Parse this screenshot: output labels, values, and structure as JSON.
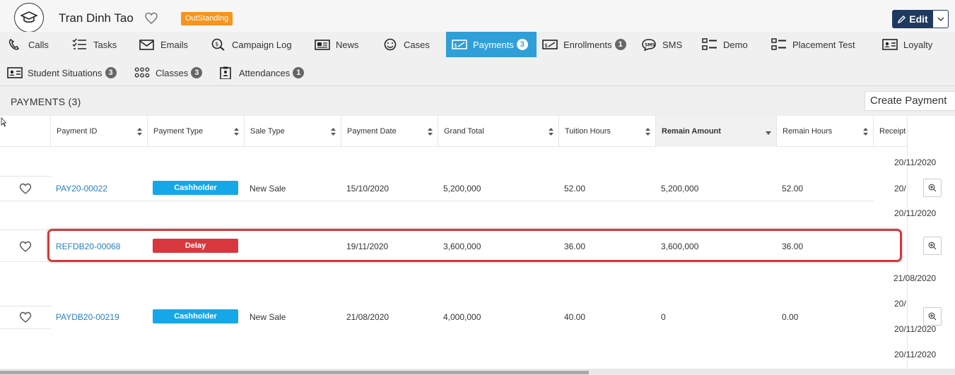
{
  "header": {
    "name": "Tran Dinh Tao",
    "status_badge": "OutStanding",
    "edit_label": "Edit",
    "brand_color": "#1f3a5f",
    "badge_color": "#f7941d"
  },
  "tabs": [
    {
      "label": "Calls",
      "icon": "phone-icon"
    },
    {
      "label": "Tasks",
      "icon": "checklist-icon"
    },
    {
      "label": "Emails",
      "icon": "envelope-icon"
    },
    {
      "label": "Campaign Log",
      "icon": "search-dollar-icon"
    },
    {
      "label": "News",
      "icon": "newspaper-icon"
    },
    {
      "label": "Cases",
      "icon": "smile-icon"
    },
    {
      "label": "Payments",
      "icon": "bill-icon",
      "count": "3",
      "active": true
    },
    {
      "label": "Enrollments",
      "icon": "bill-icon",
      "count": "1"
    },
    {
      "label": "SMS",
      "icon": "sms-icon"
    },
    {
      "label": "Demo",
      "icon": "list-icon"
    },
    {
      "label": "Placement Test",
      "icon": "list-icon"
    },
    {
      "label": "Loyalty",
      "icon": "id-card-icon"
    },
    {
      "label": "Student Situations",
      "icon": "id-card-icon",
      "count": "3"
    },
    {
      "label": "Classes",
      "icon": "group-icon",
      "count": "3"
    },
    {
      "label": "Attendances",
      "icon": "clipboard-icon",
      "count": "1"
    }
  ],
  "section": {
    "title": "PAYMENTS",
    "count": "(3)",
    "create_label": "Create Payment"
  },
  "columns": [
    "Payment ID",
    "Payment Type",
    "Sale Type",
    "Payment Date",
    "Grand Total",
    "Tuition Hours",
    "Remain Amount",
    "Remain Hours",
    "Receipt"
  ],
  "rows": [
    {
      "id": "PAY20-00022",
      "type": "Cashholder",
      "sale": "New Sale",
      "date": "15/10/2020",
      "total": "5,200,000",
      "hours": "52.00",
      "remain_amount": "5,200,000",
      "remain_hours": "52.00",
      "receipts": [
        "20/11/2020",
        "20/",
        "20/11/2020"
      ]
    },
    {
      "id": "REFDB20-00068",
      "type": "Delay",
      "sale": "",
      "date": "19/11/2020",
      "total": "3,600,000",
      "hours": "36.00",
      "remain_amount": "3,600,000",
      "remain_hours": "36.00",
      "receipts": []
    },
    {
      "id": "PAYDB20-00219",
      "type": "Cashholder",
      "sale": "New Sale",
      "date": "21/08/2020",
      "total": "4,000,000",
      "hours": "40.00",
      "remain_amount": "0",
      "remain_hours": "0.00",
      "receipts": [
        "21/08/2020",
        "20/",
        "20/11/2020",
        "20/11/2020"
      ]
    }
  ],
  "colors": {
    "active_tab": "#2f9fd8",
    "cashholder": "#16a7e9",
    "delay": "#d8373e",
    "link": "#2a7fbd",
    "highlight": "#d33a3a"
  }
}
